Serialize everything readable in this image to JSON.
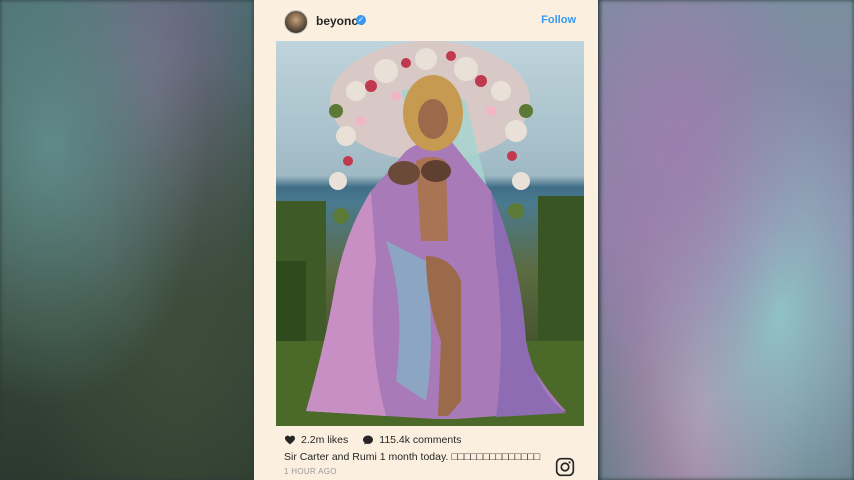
{
  "post": {
    "username": "beyonce",
    "follow_label": "Follow",
    "likes": "2.2m likes",
    "comments": "115.4k comments",
    "caption": "Sir Carter and Rumi 1 month today. □□□□□□□□□□□□□□",
    "timestamp": "1 HOUR AGO"
  },
  "icons": {
    "verified": "verified-badge-icon",
    "heart": "heart-icon",
    "comment": "comment-bubble-icon",
    "instagram": "instagram-logo-icon"
  },
  "colors": {
    "card_bg": "#fbf0df",
    "link_blue": "#3897f0",
    "text": "#262626",
    "muted": "#999999"
  }
}
